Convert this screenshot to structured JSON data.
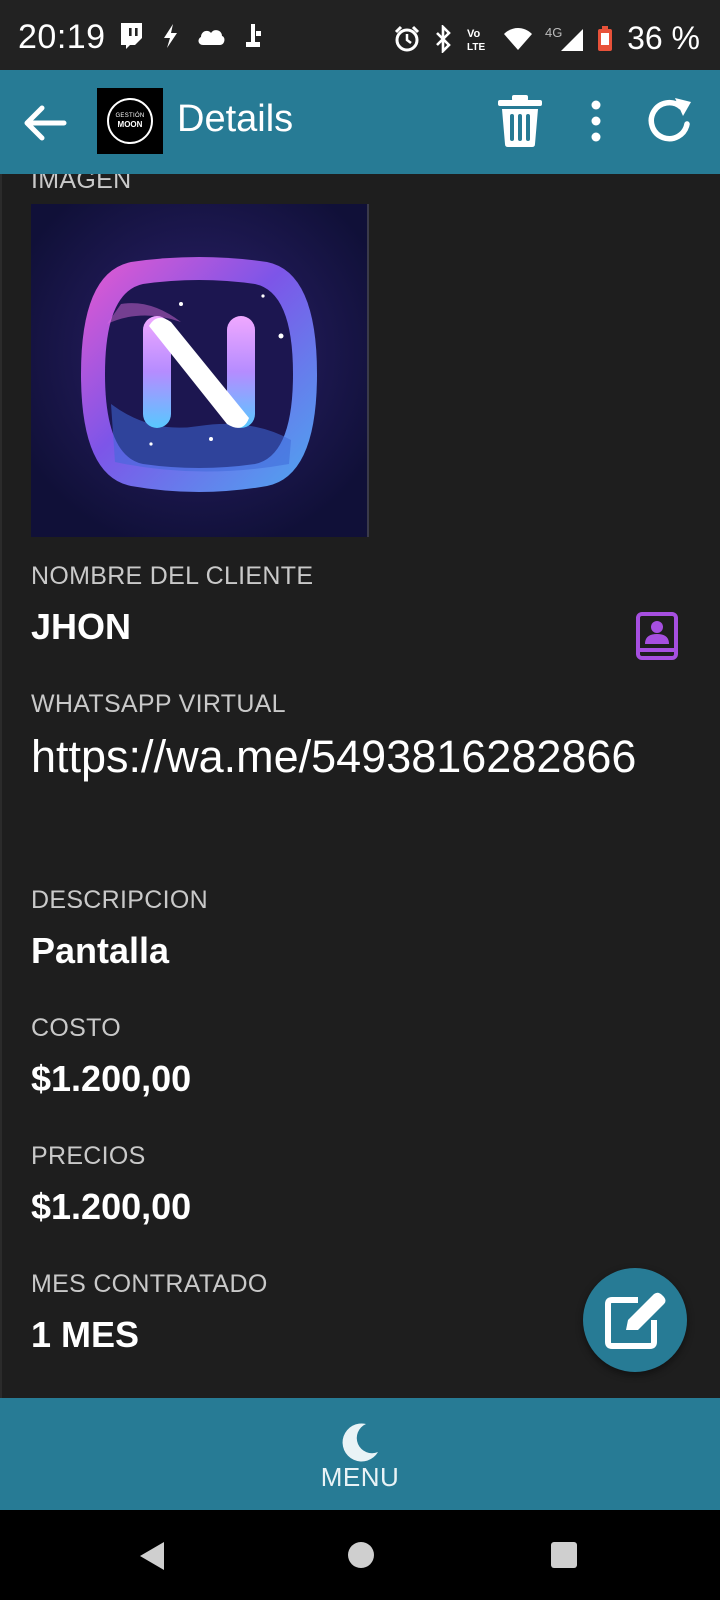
{
  "status_bar": {
    "time": "20:19",
    "battery": "36 %",
    "network": "4G",
    "volte": "Vo LTE",
    "left_icons": [
      "twitch-icon",
      "bolt-icon",
      "cloud-icon",
      "usb-icon"
    ],
    "right_icons": [
      "alarm-icon",
      "bluetooth-icon",
      "volte-icon",
      "wifi-icon",
      "signal-icon",
      "battery-icon"
    ]
  },
  "app_bar": {
    "title": "Details",
    "logo_line1": "GESTIÓN",
    "logo_line2": "MOON",
    "actions": [
      "delete-icon",
      "more-vert-icon",
      "refresh-icon"
    ]
  },
  "details": {
    "image_label": "IMAGEN",
    "client_label": "NOMBRE DEL CLIENTE",
    "client_value": "JHON",
    "whatsapp_label": "WHATSAPP VIRTUAL",
    "whatsapp_value": "https://wa.me/5493816282866",
    "description_label": "DESCRIPCION",
    "description_value": "Pantalla",
    "cost_label": "COSTO",
    "cost_value": "$1.200,00",
    "price_label": "PRECIOS",
    "price_value": "$1.200,00",
    "month_label": "MES CONTRATADO",
    "month_value": "1 MES"
  },
  "bottom_nav": {
    "label": "MENU"
  },
  "colors": {
    "primary": "#277b95",
    "background": "#1e1e1e",
    "contact_icon": "#a64fe0"
  }
}
